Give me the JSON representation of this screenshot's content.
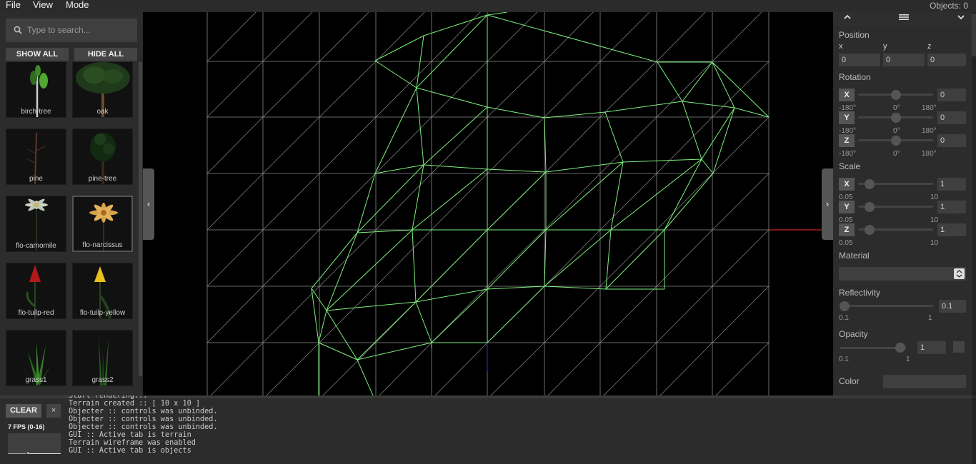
{
  "menu": {
    "file": "File",
    "view": "View",
    "mode": "Mode",
    "objects_count": "Objects: 0"
  },
  "left_panel": {
    "search_placeholder": "Type to search...",
    "show_all": "SHOW ALL",
    "hide_all": "HIDE ALL",
    "collapse_icon": "‹",
    "items": [
      {
        "label": "birch-tree",
        "icon": "birch-tree-thumbnail"
      },
      {
        "label": "oak",
        "icon": "oak-thumbnail"
      },
      {
        "label": "pine",
        "icon": "pine-thumbnail"
      },
      {
        "label": "pine-tree",
        "icon": "pine-tree-thumbnail"
      },
      {
        "label": "flo-camomile",
        "icon": "camomile-thumbnail"
      },
      {
        "label": "flo-narcissus",
        "icon": "narcissus-thumbnail",
        "selected": true
      },
      {
        "label": "flo-tuilp-red",
        "icon": "tulip-red-thumbnail"
      },
      {
        "label": "flo-tuilp-yellow",
        "icon": "tulip-yellow-thumbnail"
      },
      {
        "label": "grass1",
        "icon": "grass1-thumbnail"
      },
      {
        "label": "grass2",
        "icon": "grass2-thumbnail"
      }
    ]
  },
  "right_panel": {
    "collapse_icon": "›",
    "up_icon": "chevron-up-icon",
    "menu_icon": "hamburger-icon",
    "down_icon": "chevron-down-icon",
    "position": {
      "title": "Position",
      "x_label": "x",
      "y_label": "y",
      "z_label": "z",
      "x": "0",
      "y": "0",
      "z": "0"
    },
    "rotation": {
      "title": "Rotation",
      "axes": [
        {
          "axis": "X",
          "value": "0",
          "min": "-180°",
          "mid": "0°",
          "max": "180°",
          "level": 0.5
        },
        {
          "axis": "Y",
          "value": "0",
          "min": "-180°",
          "mid": "0°",
          "max": "180°",
          "level": 0.5
        },
        {
          "axis": "Z",
          "value": "0",
          "min": "-180°",
          "mid": "0°",
          "max": "180°",
          "level": 0.5
        }
      ]
    },
    "scale": {
      "title": "Scale",
      "axes": [
        {
          "axis": "X",
          "value": "1",
          "min": "0.05",
          "max": "10",
          "level": 0.1
        },
        {
          "axis": "Y",
          "value": "1",
          "min": "0.05",
          "max": "10",
          "level": 0.1
        },
        {
          "axis": "Z",
          "value": "1",
          "min": "0.05",
          "max": "10",
          "level": 0.1
        }
      ]
    },
    "material": {
      "title": "Material",
      "value": ""
    },
    "reflectivity": {
      "title": "Reflectivity",
      "value": "0.1",
      "min": "0.1",
      "max": "1",
      "level": 0.0
    },
    "opacity": {
      "title": "Opacity",
      "value": "1",
      "min": "0.1",
      "max": "1",
      "level": 1.0
    },
    "color": {
      "title": "Color",
      "value": ""
    }
  },
  "console": {
    "clear": "CLEAR",
    "close": "×",
    "fps": "7 FPS (0-16)",
    "log": [
      "Start rendering...",
      "Terrain created :: [ 10 x 10 ]",
      "Objecter :: controls was unbinded.",
      "Objecter :: controls was unbinded.",
      "Objecter :: controls was unbinded.",
      "GUI :: Active tab is terrain",
      "Terrain wireframe was enabled",
      "GUI :: Active tab is objects"
    ]
  },
  "viewport": {
    "mode": "terrain-wireframe",
    "grid": "10 x 10"
  },
  "colors": {
    "wire_grid": "#8a8a8a",
    "wire_terrain": "#7ef07e",
    "x_axis": "#cc2222",
    "z_axis": "#2222cc"
  }
}
